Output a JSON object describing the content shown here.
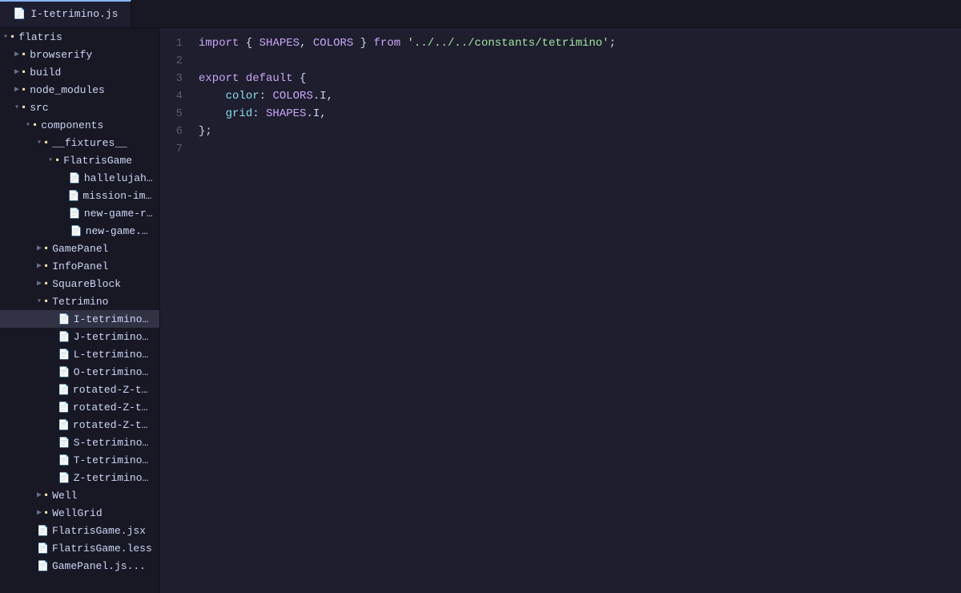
{
  "tabs": [
    {
      "id": "I-tetrimino",
      "label": "I-tetrimino.js",
      "active": true
    }
  ],
  "sidebar": {
    "tree": [
      {
        "id": "flatris",
        "label": "flatris",
        "type": "folder",
        "expanded": true,
        "level": 0
      },
      {
        "id": "browserify",
        "label": "browserify",
        "type": "folder",
        "expanded": false,
        "level": 1
      },
      {
        "id": "build",
        "label": "build",
        "type": "folder",
        "expanded": false,
        "level": 1
      },
      {
        "id": "node_modules",
        "label": "node_modules",
        "type": "folder",
        "expanded": false,
        "level": 1
      },
      {
        "id": "src",
        "label": "src",
        "type": "folder",
        "expanded": true,
        "level": 1
      },
      {
        "id": "components",
        "label": "components",
        "type": "folder",
        "expanded": true,
        "level": 2
      },
      {
        "id": "__fixtures__",
        "label": "__fixtures__",
        "type": "folder",
        "expanded": true,
        "level": 3
      },
      {
        "id": "FlatrisGame",
        "label": "FlatrisGame",
        "type": "folder",
        "expanded": true,
        "level": 4
      },
      {
        "id": "hallelujah.js",
        "label": "hallelujah.js",
        "type": "file",
        "level": 5
      },
      {
        "id": "mission-impo",
        "label": "mission-impo...",
        "type": "file",
        "level": 5
      },
      {
        "id": "new-game-r",
        "label": "new-game-r...",
        "type": "file",
        "level": 5
      },
      {
        "id": "new-game.js",
        "label": "new-game.js",
        "type": "file",
        "level": 5
      },
      {
        "id": "GamePanel",
        "label": "GamePanel",
        "type": "folder",
        "expanded": false,
        "level": 3
      },
      {
        "id": "InfoPanel",
        "label": "InfoPanel",
        "type": "folder",
        "expanded": false,
        "level": 3
      },
      {
        "id": "SquareBlock",
        "label": "SquareBlock",
        "type": "folder",
        "expanded": false,
        "level": 3
      },
      {
        "id": "Tetrimino",
        "label": "Tetrimino",
        "type": "folder",
        "expanded": true,
        "level": 3
      },
      {
        "id": "I-tetrimino.js",
        "label": "I-tetrimino.js",
        "type": "file",
        "level": 4,
        "selected": true
      },
      {
        "id": "J-tetrimino.js",
        "label": "J-tetrimino.js",
        "type": "file",
        "level": 4
      },
      {
        "id": "L-tetrimino.js",
        "label": "L-tetrimino.js",
        "type": "file",
        "level": 4
      },
      {
        "id": "O-tetrimino.js",
        "label": "O-tetrimino.js",
        "type": "file",
        "level": 4
      },
      {
        "id": "rotated-Z-te",
        "label": "rotated-Z-te...",
        "type": "file",
        "level": 4
      },
      {
        "id": "rotated-Z-te2",
        "label": "rotated-Z-te...",
        "type": "file",
        "level": 4
      },
      {
        "id": "rotated-Z-te3",
        "label": "rotated-Z-te...",
        "type": "file",
        "level": 4
      },
      {
        "id": "S-tetrimino.js",
        "label": "S-tetrimino.js",
        "type": "file",
        "level": 4
      },
      {
        "id": "T-tetrimino.js",
        "label": "T-tetrimino.js",
        "type": "file",
        "level": 4
      },
      {
        "id": "Z-tetrimino.js",
        "label": "Z-tetrimino.js",
        "type": "file",
        "level": 4
      },
      {
        "id": "Well",
        "label": "Well",
        "type": "folder",
        "expanded": false,
        "level": 3
      },
      {
        "id": "WellGrid",
        "label": "WellGrid",
        "type": "folder",
        "expanded": false,
        "level": 3
      },
      {
        "id": "FlatrisGame.jsx",
        "label": "FlatrisGame.jsx",
        "type": "file",
        "level": 2
      },
      {
        "id": "FlatrisGame.less",
        "label": "FlatrisGame.less",
        "type": "file",
        "level": 2
      },
      {
        "id": "GamePanel.js",
        "label": "GamePanel.js...",
        "type": "file",
        "level": 2
      }
    ]
  },
  "editor": {
    "filename": "I-tetrimino.js",
    "lines": [
      {
        "num": 1,
        "content": "import { SHAPES, COLORS } from '../../../constants/tetrimino';"
      },
      {
        "num": 2,
        "content": ""
      },
      {
        "num": 3,
        "content": "export default {"
      },
      {
        "num": 4,
        "content": "    color: COLORS.I,"
      },
      {
        "num": 5,
        "content": "    grid: SHAPES.I,"
      },
      {
        "num": 6,
        "content": "};"
      },
      {
        "num": 7,
        "content": ""
      }
    ]
  }
}
